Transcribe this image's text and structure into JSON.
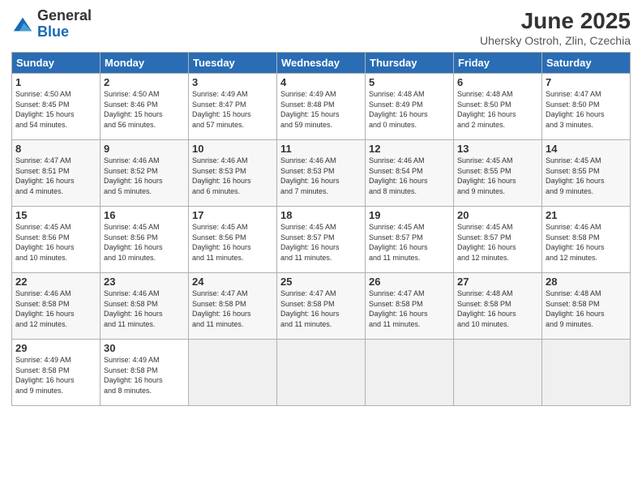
{
  "logo": {
    "general": "General",
    "blue": "Blue"
  },
  "title": "June 2025",
  "subtitle": "Uhersky Ostroh, Zlin, Czechia",
  "days_header": [
    "Sunday",
    "Monday",
    "Tuesday",
    "Wednesday",
    "Thursday",
    "Friday",
    "Saturday"
  ],
  "weeks": [
    [
      {
        "day": "1",
        "info": "Sunrise: 4:50 AM\nSunset: 8:45 PM\nDaylight: 15 hours\nand 54 minutes."
      },
      {
        "day": "2",
        "info": "Sunrise: 4:50 AM\nSunset: 8:46 PM\nDaylight: 15 hours\nand 56 minutes."
      },
      {
        "day": "3",
        "info": "Sunrise: 4:49 AM\nSunset: 8:47 PM\nDaylight: 15 hours\nand 57 minutes."
      },
      {
        "day": "4",
        "info": "Sunrise: 4:49 AM\nSunset: 8:48 PM\nDaylight: 15 hours\nand 59 minutes."
      },
      {
        "day": "5",
        "info": "Sunrise: 4:48 AM\nSunset: 8:49 PM\nDaylight: 16 hours\nand 0 minutes."
      },
      {
        "day": "6",
        "info": "Sunrise: 4:48 AM\nSunset: 8:50 PM\nDaylight: 16 hours\nand 2 minutes."
      },
      {
        "day": "7",
        "info": "Sunrise: 4:47 AM\nSunset: 8:50 PM\nDaylight: 16 hours\nand 3 minutes."
      }
    ],
    [
      {
        "day": "8",
        "info": "Sunrise: 4:47 AM\nSunset: 8:51 PM\nDaylight: 16 hours\nand 4 minutes."
      },
      {
        "day": "9",
        "info": "Sunrise: 4:46 AM\nSunset: 8:52 PM\nDaylight: 16 hours\nand 5 minutes."
      },
      {
        "day": "10",
        "info": "Sunrise: 4:46 AM\nSunset: 8:53 PM\nDaylight: 16 hours\nand 6 minutes."
      },
      {
        "day": "11",
        "info": "Sunrise: 4:46 AM\nSunset: 8:53 PM\nDaylight: 16 hours\nand 7 minutes."
      },
      {
        "day": "12",
        "info": "Sunrise: 4:46 AM\nSunset: 8:54 PM\nDaylight: 16 hours\nand 8 minutes."
      },
      {
        "day": "13",
        "info": "Sunrise: 4:45 AM\nSunset: 8:55 PM\nDaylight: 16 hours\nand 9 minutes."
      },
      {
        "day": "14",
        "info": "Sunrise: 4:45 AM\nSunset: 8:55 PM\nDaylight: 16 hours\nand 9 minutes."
      }
    ],
    [
      {
        "day": "15",
        "info": "Sunrise: 4:45 AM\nSunset: 8:56 PM\nDaylight: 16 hours\nand 10 minutes."
      },
      {
        "day": "16",
        "info": "Sunrise: 4:45 AM\nSunset: 8:56 PM\nDaylight: 16 hours\nand 10 minutes."
      },
      {
        "day": "17",
        "info": "Sunrise: 4:45 AM\nSunset: 8:56 PM\nDaylight: 16 hours\nand 11 minutes."
      },
      {
        "day": "18",
        "info": "Sunrise: 4:45 AM\nSunset: 8:57 PM\nDaylight: 16 hours\nand 11 minutes."
      },
      {
        "day": "19",
        "info": "Sunrise: 4:45 AM\nSunset: 8:57 PM\nDaylight: 16 hours\nand 11 minutes."
      },
      {
        "day": "20",
        "info": "Sunrise: 4:45 AM\nSunset: 8:57 PM\nDaylight: 16 hours\nand 12 minutes."
      },
      {
        "day": "21",
        "info": "Sunrise: 4:46 AM\nSunset: 8:58 PM\nDaylight: 16 hours\nand 12 minutes."
      }
    ],
    [
      {
        "day": "22",
        "info": "Sunrise: 4:46 AM\nSunset: 8:58 PM\nDaylight: 16 hours\nand 12 minutes."
      },
      {
        "day": "23",
        "info": "Sunrise: 4:46 AM\nSunset: 8:58 PM\nDaylight: 16 hours\nand 11 minutes."
      },
      {
        "day": "24",
        "info": "Sunrise: 4:47 AM\nSunset: 8:58 PM\nDaylight: 16 hours\nand 11 minutes."
      },
      {
        "day": "25",
        "info": "Sunrise: 4:47 AM\nSunset: 8:58 PM\nDaylight: 16 hours\nand 11 minutes."
      },
      {
        "day": "26",
        "info": "Sunrise: 4:47 AM\nSunset: 8:58 PM\nDaylight: 16 hours\nand 11 minutes."
      },
      {
        "day": "27",
        "info": "Sunrise: 4:48 AM\nSunset: 8:58 PM\nDaylight: 16 hours\nand 10 minutes."
      },
      {
        "day": "28",
        "info": "Sunrise: 4:48 AM\nSunset: 8:58 PM\nDaylight: 16 hours\nand 9 minutes."
      }
    ],
    [
      {
        "day": "29",
        "info": "Sunrise: 4:49 AM\nSunset: 8:58 PM\nDaylight: 16 hours\nand 9 minutes."
      },
      {
        "day": "30",
        "info": "Sunrise: 4:49 AM\nSunset: 8:58 PM\nDaylight: 16 hours\nand 8 minutes."
      },
      {
        "day": "",
        "info": ""
      },
      {
        "day": "",
        "info": ""
      },
      {
        "day": "",
        "info": ""
      },
      {
        "day": "",
        "info": ""
      },
      {
        "day": "",
        "info": ""
      }
    ]
  ]
}
